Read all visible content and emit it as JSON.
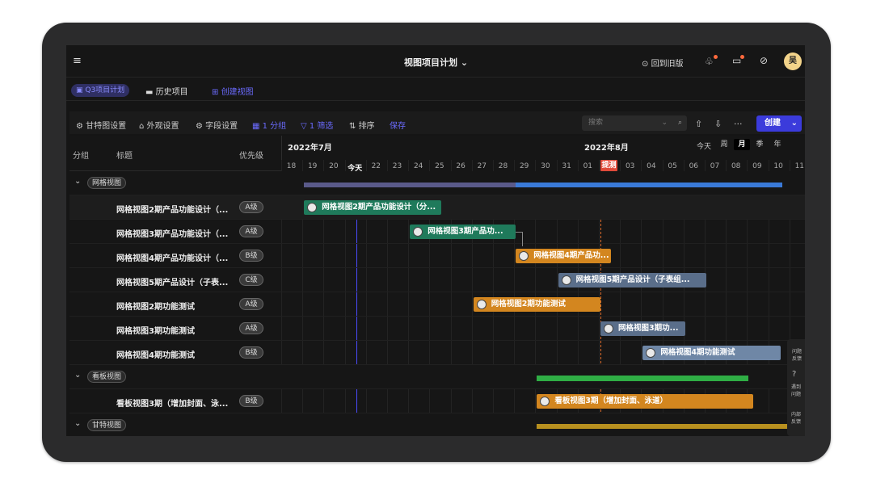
{
  "topbar": {
    "title": "视图项目计划 ⌄",
    "back_old": "回到旧版",
    "avatar": "吴"
  },
  "subbar": {
    "active_tab": "Q3项目计划",
    "history": "历史项目",
    "create_view": "创建视图"
  },
  "toolbar": {
    "gantt_settings": "甘特图设置",
    "appearance": "外观设置",
    "fields": "字段设置",
    "group": "1 分组",
    "filter": "1 筛选",
    "sort": "排序",
    "save": "保存",
    "search_placeholder": "搜索",
    "create": "创建"
  },
  "header": {
    "col_group": "分组",
    "col_title": "标题",
    "col_priority": "优先级",
    "month1": "2022年7月",
    "month2": "2022年8月",
    "today_btn": "今天",
    "scales": [
      "周",
      "月",
      "季",
      "年"
    ],
    "days": [
      "18",
      "19",
      "20",
      "今天",
      "22",
      "23",
      "24",
      "25",
      "26",
      "27",
      "28",
      "29",
      "30",
      "31",
      "01",
      "提测",
      "03",
      "04",
      "05",
      "06",
      "07",
      "08",
      "09",
      "10",
      "11"
    ]
  },
  "groups": [
    {
      "name": "网格视图",
      "items": [
        {
          "title": "网格视图2期产品功能设计（...",
          "priority": "A级",
          "bar": "网格视图2期产品功能设计（分..."
        },
        {
          "title": "网格视图3期产品功能设计（...",
          "priority": "A级",
          "bar": "网格视图3期产品功..."
        },
        {
          "title": "网格视图4期产品功能设计（...",
          "priority": "B级",
          "bar": "网格视图4期产品功..."
        },
        {
          "title": "网格视图5期产品设计（子表...",
          "priority": "C级",
          "bar": "网格视图5期产品设计（子表组..."
        },
        {
          "title": "网格视图2期功能测试",
          "priority": "A级",
          "bar": "网格视图2期功能测试"
        },
        {
          "title": "网格视图3期功能测试",
          "priority": "A级",
          "bar": "网格视图3期功..."
        },
        {
          "title": "网格视图4期功能测试",
          "priority": "B级",
          "bar": "网格视图4期功能测试"
        }
      ]
    },
    {
      "name": "看板视图",
      "items": [
        {
          "title": "看板视图3期（增加封面、泳...",
          "priority": "B级",
          "bar": "看板视图3期（增加封面、泳道）"
        }
      ]
    },
    {
      "name": "甘特视图",
      "items": []
    }
  ],
  "side_help": {
    "a": "问题反馈",
    "b": "遇到问题",
    "c": "内部反馈"
  }
}
